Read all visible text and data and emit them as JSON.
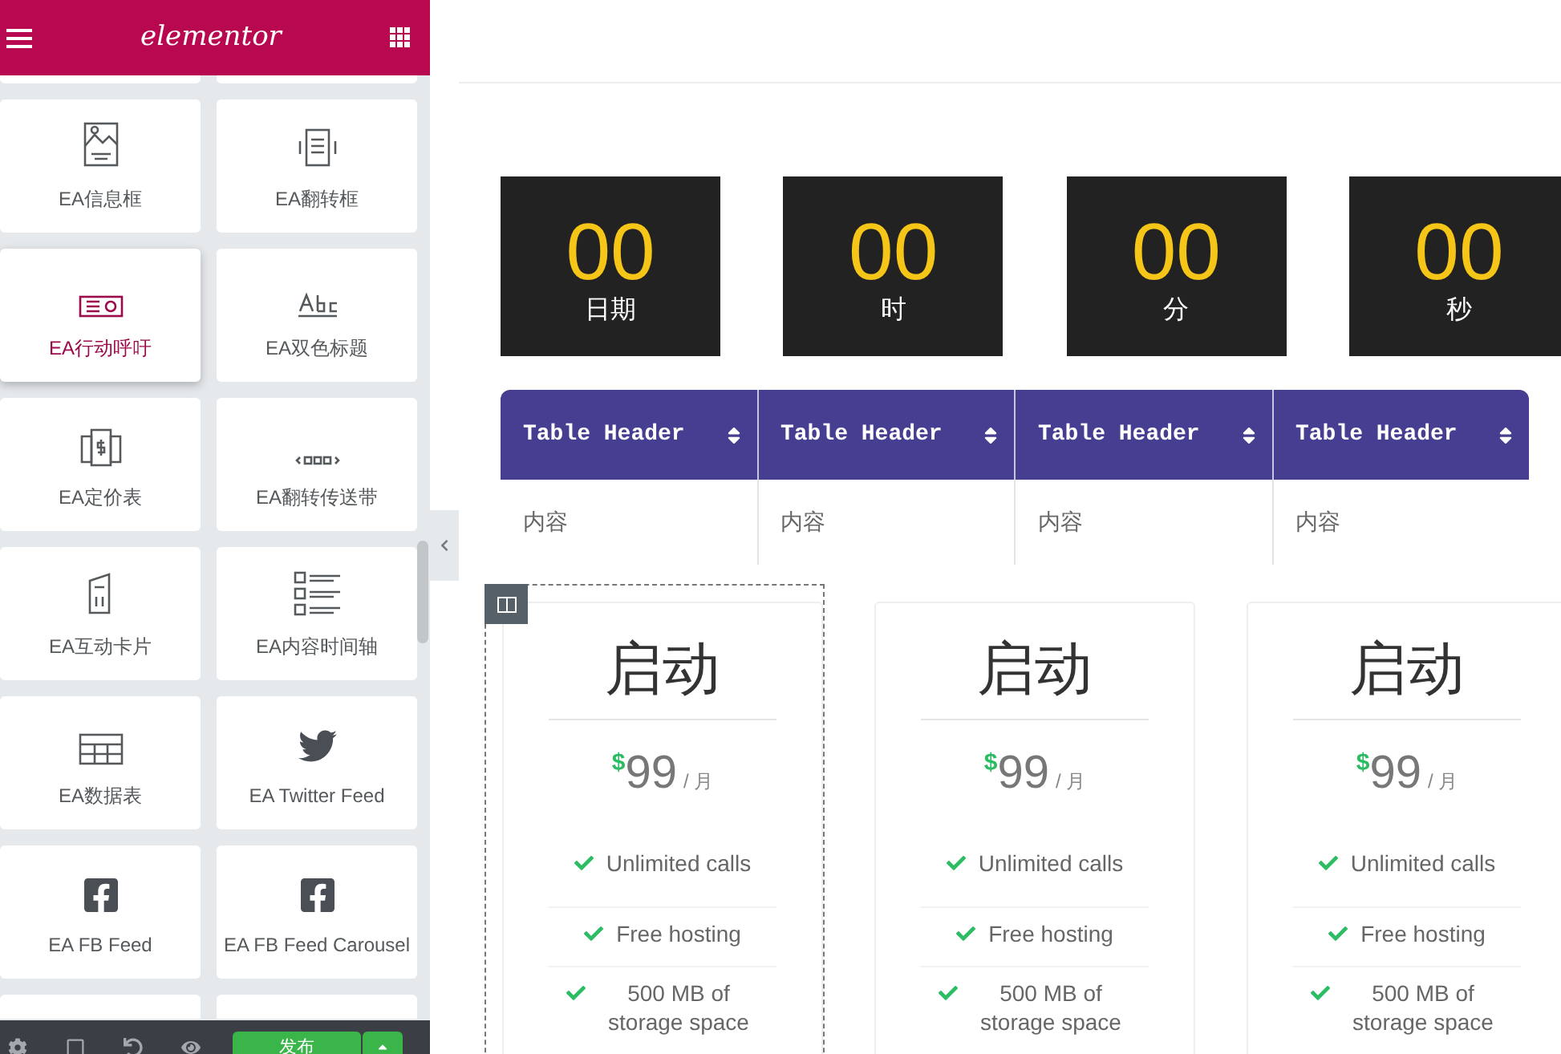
{
  "sidebar": {
    "logo": "elementor",
    "widgets": [
      {
        "label": "EA信息框",
        "selected": false
      },
      {
        "label": "EA翻转框",
        "selected": false
      },
      {
        "label": "EA行动呼吁",
        "selected": true
      },
      {
        "label": "EA双色标题",
        "selected": false
      },
      {
        "label": "EA定价表",
        "selected": false
      },
      {
        "label": "EA翻转传送带",
        "selected": false
      },
      {
        "label": "EA互动卡片",
        "selected": false
      },
      {
        "label": "EA内容时间轴",
        "selected": false
      },
      {
        "label": "EA数据表",
        "selected": false
      },
      {
        "label": "EA Twitter Feed",
        "selected": false
      },
      {
        "label": "EA FB Feed",
        "selected": false
      },
      {
        "label": "EA FB Feed Carousel",
        "selected": false
      }
    ],
    "publish_button": "发布"
  },
  "countdown": [
    {
      "value": "00",
      "unit": "日期"
    },
    {
      "value": "00",
      "unit": "时"
    },
    {
      "value": "00",
      "unit": "分"
    },
    {
      "value": "00",
      "unit": "秒"
    }
  ],
  "table": {
    "columns": [
      "Table Header",
      "Table Header",
      "Table Header",
      "Table Header"
    ],
    "rows": [
      [
        "内容",
        "内容",
        "内容",
        "内容"
      ]
    ]
  },
  "pricing": [
    {
      "title": "启动",
      "currency": "$",
      "price": "99",
      "period": "/ 月",
      "features": [
        "Unlimited calls",
        "Free hosting",
        "500 MB of storage space"
      ],
      "selected": true
    },
    {
      "title": "启动",
      "currency": "$",
      "price": "99",
      "period": "/ 月",
      "features": [
        "Unlimited calls",
        "Free hosting",
        "500 MB of storage space"
      ],
      "selected": false
    },
    {
      "title": "启动",
      "currency": "$",
      "price": "99",
      "period": "/ 月",
      "features": [
        "Unlimited calls",
        "Free hosting",
        "500 MB of storage space"
      ],
      "selected": false
    }
  ]
}
